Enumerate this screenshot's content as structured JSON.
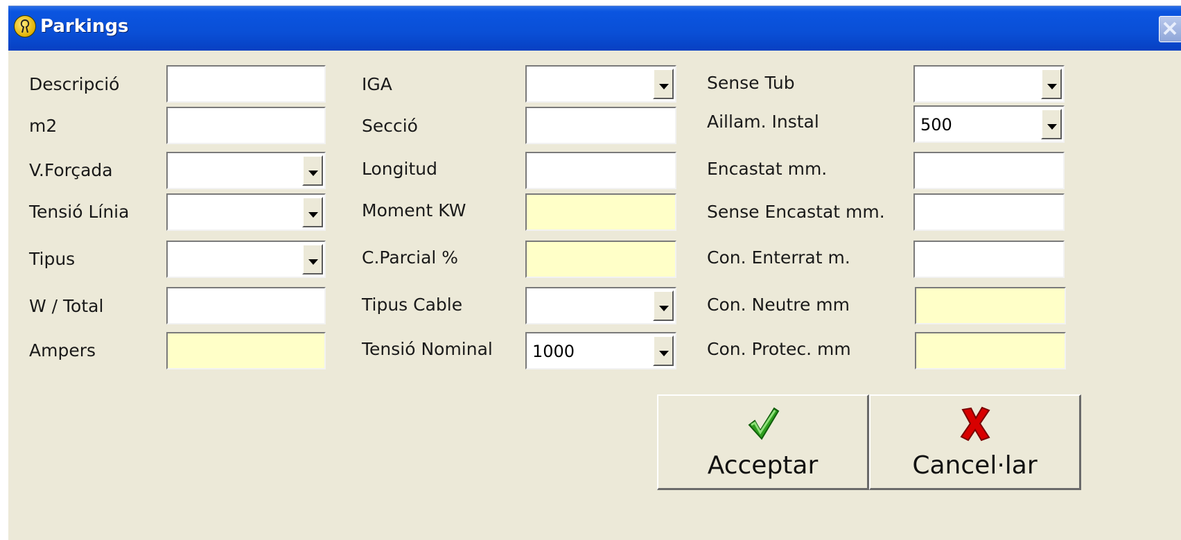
{
  "window": {
    "title": "Parkings"
  },
  "col1": [
    {
      "label": "Descripció",
      "type": "text",
      "value": ""
    },
    {
      "label": "m2",
      "type": "text",
      "value": ""
    },
    {
      "label": "V.Forçada",
      "type": "combo",
      "value": ""
    },
    {
      "label": "Tensió Línia",
      "type": "combo",
      "value": ""
    },
    {
      "label": "Tipus",
      "type": "combo",
      "value": ""
    },
    {
      "label": "W / Total",
      "type": "text",
      "value": ""
    },
    {
      "label": "Ampers",
      "type": "readonly",
      "value": ""
    }
  ],
  "col2": [
    {
      "label": "IGA",
      "type": "combo",
      "value": ""
    },
    {
      "label": "Secció",
      "type": "text",
      "value": ""
    },
    {
      "label": "Longitud",
      "type": "text",
      "value": ""
    },
    {
      "label": "Moment KW",
      "type": "readonly",
      "value": ""
    },
    {
      "label": "C.Parcial %",
      "type": "readonly",
      "value": ""
    },
    {
      "label": "Tipus Cable",
      "type": "combo",
      "value": ""
    },
    {
      "label": "Tensió Nominal",
      "type": "combo",
      "value": "1000"
    }
  ],
  "col3": [
    {
      "label": "Sense Tub",
      "type": "combo",
      "value": ""
    },
    {
      "label": "Aillam. Instal",
      "type": "combo",
      "value": "500"
    },
    {
      "label": "Encastat mm.",
      "type": "text",
      "value": ""
    },
    {
      "label": "Sense Encastat mm.",
      "type": "text",
      "value": ""
    },
    {
      "label": "Con. Enterrat m.",
      "type": "text",
      "value": ""
    },
    {
      "label": "Con. Neutre mm",
      "type": "readonly",
      "value": ""
    },
    {
      "label": "Con. Protec. mm",
      "type": "readonly",
      "value": ""
    }
  ],
  "buttons": {
    "accept": "Acceptar",
    "cancel": "Cancel·lar"
  },
  "colors": {
    "readonly_bg": "#ffffc8",
    "titlebar": "#0a4fd6",
    "check": "#2e9e1e",
    "cross": "#d80000"
  },
  "icons": {
    "app": "app-logo-icon",
    "close": "close-icon",
    "accept": "checkmark-icon",
    "cancel": "cross-icon"
  }
}
